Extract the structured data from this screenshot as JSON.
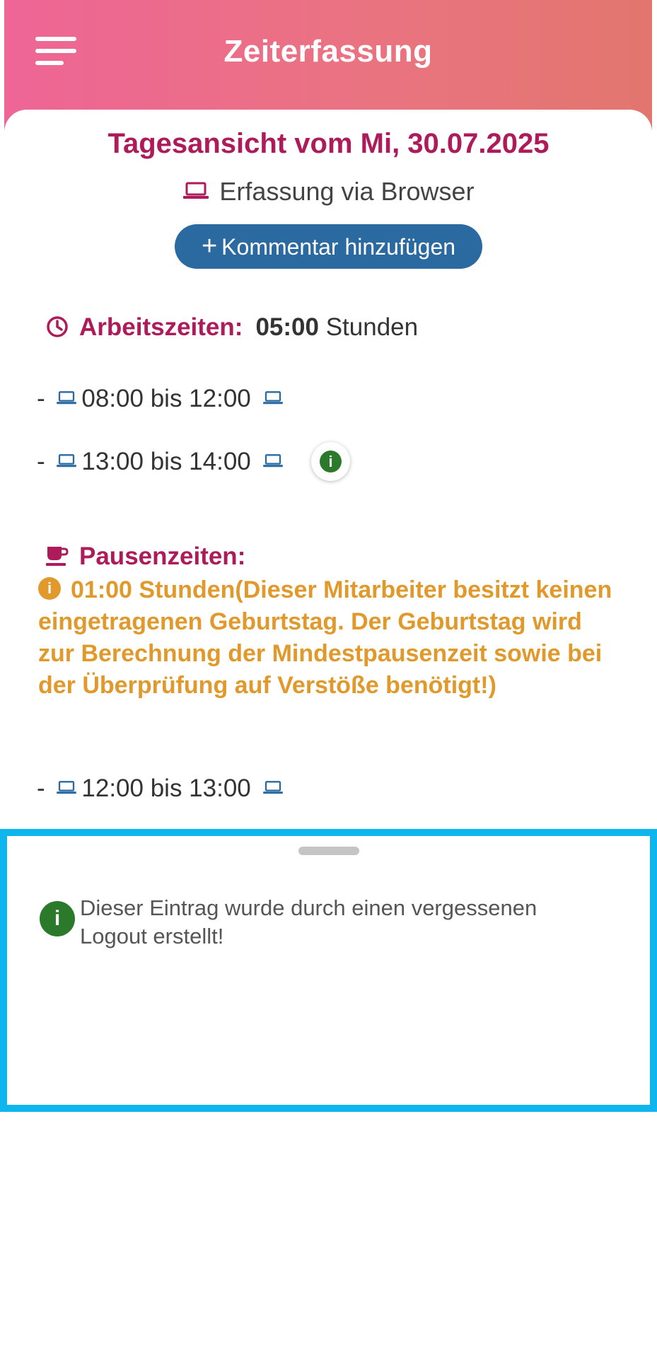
{
  "header": {
    "title": "Zeiterfassung",
    "menu_icon": "menu-icon"
  },
  "day": {
    "title": "Tagesansicht vom Mi, 30.07.2025",
    "source_label": "Erfassung via Browser",
    "add_comment_label": "Kommentar hinzufügen"
  },
  "work": {
    "label": "Arbeitszeiten:",
    "total": "05:00",
    "unit": "Stunden",
    "entries": [
      {
        "prefix": "-",
        "text": "08:00 bis 12:00"
      },
      {
        "prefix": "-",
        "text": "13:00 bis 14:00"
      }
    ]
  },
  "pause": {
    "label": "Pausenzeiten:",
    "warning": "01:00 Stunden(Dieser Mitarbeiter besitzt keinen eingetragenen Geburtstag. Der Geburtstag wird zur Berechnung der Mindestpausenzeit sowie bei der Überprüfung auf Verstöße benötigt!)",
    "entries": [
      {
        "prefix": "-",
        "text": "12:00 bis 13:00"
      }
    ]
  },
  "info_sheet": {
    "message": "Dieser Eintrag wurde durch einen vergessenen Logout erstellt!"
  },
  "colors": {
    "header_gradient_start": "#ee6596",
    "header_gradient_end": "#e2766e",
    "accent": "#ad1b5a",
    "button": "#2b6aa0",
    "device_icon": "#2b6aa0",
    "warning": "#e0992a",
    "info_green": "#2b7a2b",
    "sheet_border": "#0fb6ee"
  }
}
